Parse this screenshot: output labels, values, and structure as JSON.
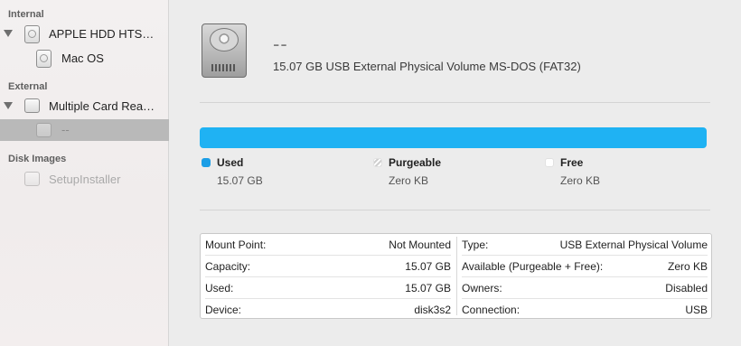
{
  "sidebar": {
    "sections": {
      "internal": "Internal",
      "external": "External",
      "disk_images": "Disk Images"
    },
    "items": {
      "apple_hdd": "APPLE HDD HTS…",
      "mac_os": "Mac OS",
      "card_reader": "Multiple Card Rea…",
      "selected_volume": "--",
      "setup_installer": "SetupInstaller"
    }
  },
  "volume": {
    "name": "--",
    "description": "15.07 GB USB External Physical Volume MS-DOS (FAT32)",
    "icon": "hard-drive-icon"
  },
  "usage": {
    "used_fraction": 1.0,
    "bar_color": "#1fb2f3",
    "legend": [
      {
        "label": "Used",
        "value": "15.07 GB",
        "color": "#1b9ee6"
      },
      {
        "label": "Purgeable",
        "value": "Zero KB",
        "color": "#cfcfcf"
      },
      {
        "label": "Free",
        "value": "Zero KB",
        "color": "#ffffff"
      }
    ]
  },
  "info": {
    "left": [
      {
        "key": "Mount Point:",
        "value": "Not Mounted"
      },
      {
        "key": "Capacity:",
        "value": "15.07 GB"
      },
      {
        "key": "Used:",
        "value": "15.07 GB"
      },
      {
        "key": "Device:",
        "value": "disk3s2"
      }
    ],
    "right": [
      {
        "key": "Type:",
        "value": "USB External Physical Volume"
      },
      {
        "key": "Available (Purgeable + Free):",
        "value": "Zero KB"
      },
      {
        "key": "Owners:",
        "value": "Disabled"
      },
      {
        "key": "Connection:",
        "value": "USB"
      }
    ]
  }
}
